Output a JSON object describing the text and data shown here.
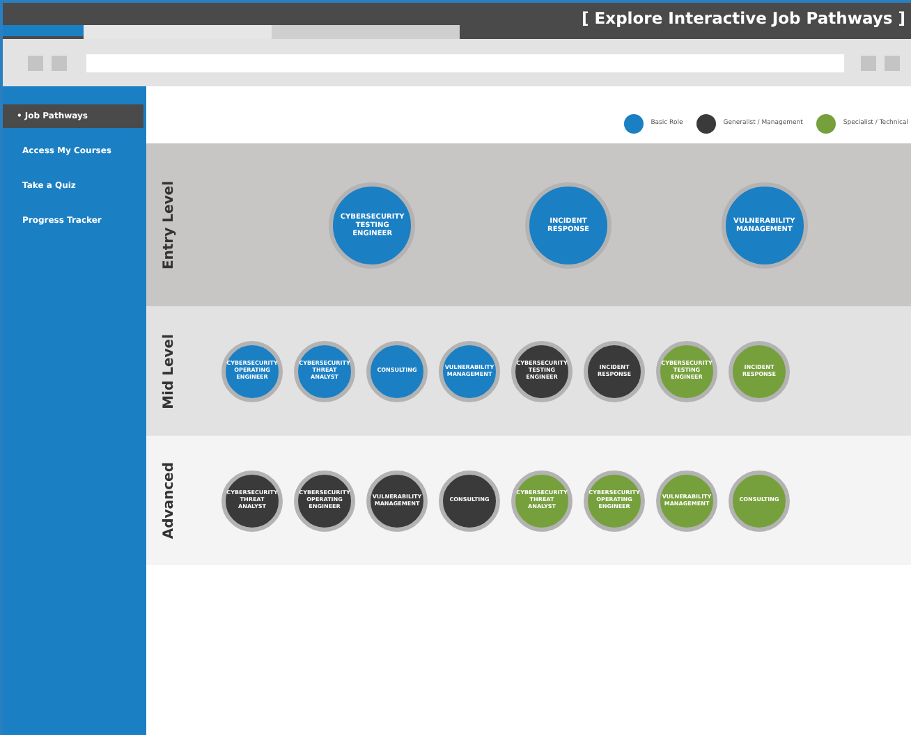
{
  "window": {
    "title": "[ Explore Interactive Job Pathways ]",
    "tabs": [
      {
        "selected": true
      },
      {
        "selected": false
      },
      {
        "selected": false
      }
    ]
  },
  "sidebar": {
    "items": [
      {
        "label": "• Job Pathways",
        "selected": true
      },
      {
        "label": "Access My Courses",
        "selected": false
      },
      {
        "label": "Take a Quiz",
        "selected": false
      },
      {
        "label": "Progress Tracker",
        "selected": false
      }
    ]
  },
  "legend": [
    {
      "label": "Basic Role",
      "color": "#1b7fc4"
    },
    {
      "label": "Generalist / Management",
      "color": "#3a3a3a"
    },
    {
      "label": "Specialist / Technical",
      "color": "#76a03c"
    }
  ],
  "levels": [
    {
      "label": "Entry Level",
      "kind": "featured",
      "roles": [
        {
          "label": "CYBERSECURITY TESTING ENGINEER",
          "color": "#1b7fc4"
        },
        {
          "label": "INCIDENT RESPONSE",
          "color": "#1b7fc4"
        },
        {
          "label": "VULNERABILITY MANAGEMENT",
          "color": "#1b7fc4"
        }
      ]
    },
    {
      "label": "Mid Level",
      "kind": "compact",
      "roles": [
        {
          "label": "CYBERSECURITY OPERATING ENGINEER",
          "color": "#1b7fc4"
        },
        {
          "label": "CYBERSECURITY THREAT ANALYST",
          "color": "#1b7fc4"
        },
        {
          "label": "CONSULTING",
          "color": "#1b7fc4"
        },
        {
          "label": "VULNERABILITY MANAGEMENT",
          "color": "#1b7fc4"
        },
        {
          "label": "CYBERSECURITY TESTING ENGINEER",
          "color": "#3a3a3a"
        },
        {
          "label": "INCIDENT RESPONSE",
          "color": "#3a3a3a"
        },
        {
          "label": "CYBERSECURITY TESTING ENGINEER",
          "color": "#76a03c"
        },
        {
          "label": "INCIDENT RESPONSE",
          "color": "#76a03c"
        }
      ]
    },
    {
      "label": "Advanced",
      "kind": "compact",
      "roles": [
        {
          "label": "CYBERSECURITY THREAT ANALYST",
          "color": "#3a3a3a"
        },
        {
          "label": "CYBERSECURITY OPERATING ENGINEER",
          "color": "#3a3a3a"
        },
        {
          "label": "VULNERABILITY MANAGEMENT",
          "color": "#3a3a3a"
        },
        {
          "label": "CONSULTING",
          "color": "#3a3a3a"
        },
        {
          "label": "CYBERSECURITY THREAT ANALYST",
          "color": "#76a03c"
        },
        {
          "label": "CYBERSECURITY OPERATING ENGINEER",
          "color": "#76a03c"
        },
        {
          "label": "VULNERABILITY MANAGEMENT",
          "color": "#76a03c"
        },
        {
          "label": "CONSULTING",
          "color": "#76a03c"
        }
      ]
    }
  ]
}
